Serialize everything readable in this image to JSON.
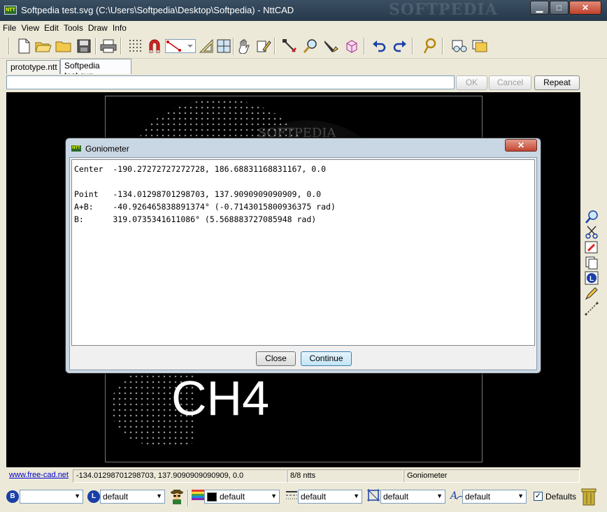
{
  "window": {
    "title": "Softpedia test.svg (C:\\Users\\Softpedia\\Desktop\\Softpedia) - NttCAD",
    "app_icon_text": "NTT",
    "brand_watermark": "SOFTPEDIA",
    "minimize": "▁",
    "maximize": "□",
    "close": "✕"
  },
  "menu": [
    "File",
    "View",
    "Edit",
    "Tools",
    "Draw",
    "Info"
  ],
  "toolbar_icons": [
    "new-file-icon",
    "open-folder-icon",
    "folder-icon",
    "save-icon",
    "print-icon",
    "grid-icon",
    "magnet-snap-icon",
    "line-tool-icon",
    "set-square-icon",
    "crosshair-icon",
    "pan-hand-icon",
    "edit-node-icon",
    "cut-tool-icon",
    "zoom-icon",
    "pen-tool-icon",
    "3d-box-icon",
    "undo-icon",
    "redo-icon",
    "rope-icon",
    "glasses-icon",
    "layers-icon"
  ],
  "tabs": [
    {
      "label": "prototype.ntt",
      "active": false
    },
    {
      "label": "Softpedia test.svg",
      "active": true
    }
  ],
  "command": {
    "value": "",
    "ok": "OK",
    "cancel": "Cancel",
    "repeat": "Repeat"
  },
  "canvas": {
    "text": "CH4",
    "watermark": "SOFTPEDIA"
  },
  "right_toolbar_icons": [
    "magnifier-icon",
    "scissors-icon",
    "sign-icon",
    "copy-icon",
    "layer-l-icon",
    "pencil-icon",
    "measure-icon"
  ],
  "status": {
    "link": "www.free-cad.net",
    "coords": "-134.01298701298703, 137.9090909090909, 0.0",
    "count": "8/8 ntts",
    "mode": "Goniometer"
  },
  "bottom": {
    "b_icon": "B",
    "b_value": "",
    "l_icon": "L",
    "l_value": "default",
    "color_value": "default",
    "linetype_value": "default",
    "hatch_value": "default",
    "font_value": "default",
    "defaults_label": "Defaults",
    "defaults_checked": true
  },
  "dialog": {
    "title": "Goniometer",
    "lines": [
      "Center  -190.27272727272728, 186.68831168831167, 0.0",
      "",
      "Point   -134.01298701298703, 137.9090909090909, 0.0",
      "A+B:    -40.926465838891374° (-0.7143015800936375 rad)",
      "B:      319.0735341611086° (5.568883727085948 rad)"
    ],
    "close_label": "Close",
    "continue_label": "Continue"
  },
  "colors": {
    "canvas_bg": "#000000",
    "titlebar": "#2f4356",
    "dialog_frame": "#c9d6e3",
    "link": "#0000cc"
  }
}
